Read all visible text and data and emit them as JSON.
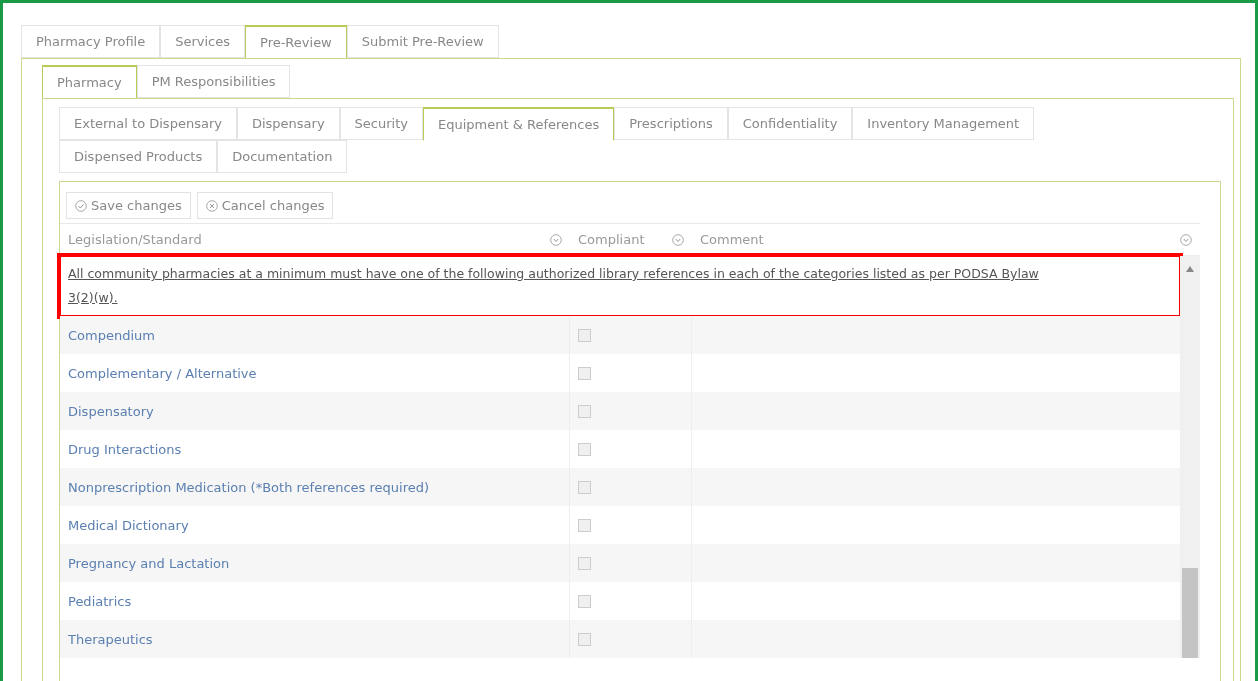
{
  "main_tabs": [
    {
      "label": "Pharmacy Profile",
      "selected": false
    },
    {
      "label": "Services",
      "selected": false
    },
    {
      "label": "Pre-Review",
      "selected": true
    },
    {
      "label": "Submit Pre-Review",
      "selected": false
    }
  ],
  "sub_tabs": [
    {
      "label": "Pharmacy",
      "selected": true
    },
    {
      "label": "PM Responsibilities",
      "selected": false
    }
  ],
  "section_tabs": [
    {
      "label": "External to Dispensary",
      "selected": false
    },
    {
      "label": "Dispensary",
      "selected": false
    },
    {
      "label": "Security",
      "selected": false
    },
    {
      "label": "Equipment & References",
      "selected": true
    },
    {
      "label": "Prescriptions",
      "selected": false
    },
    {
      "label": "Confidentiality",
      "selected": false
    },
    {
      "label": "Inventory Management",
      "selected": false
    },
    {
      "label": "Dispensed Products",
      "selected": false
    },
    {
      "label": "Documentation",
      "selected": false
    }
  ],
  "toolbar": [
    {
      "kind": "save",
      "label": "Save changes"
    },
    {
      "kind": "cancel",
      "label": "Cancel changes"
    }
  ],
  "table": {
    "columns": [
      "Legislation/Standard",
      "Compliant",
      "Comment"
    ],
    "note": {
      "text": "All community pharmacies at a minimum must have one of the following authorized library references in each of the categories listed as per PODSA Bylaw 3(2)(w).",
      "highlighted": true
    },
    "rows": [
      {
        "standard": "Compendium",
        "compliant": false
      },
      {
        "standard": "Complementary / Alternative",
        "compliant": false
      },
      {
        "standard": "Dispensatory",
        "compliant": false
      },
      {
        "standard": "Drug Interactions",
        "compliant": false
      },
      {
        "standard": "Nonprescription Medication (*Both references required)",
        "compliant": false
      },
      {
        "standard": "Medical Dictionary",
        "compliant": false
      },
      {
        "standard": "Pregnancy and Lactation",
        "compliant": false
      },
      {
        "standard": "Pediatrics",
        "compliant": false
      },
      {
        "standard": "Therapeutics",
        "compliant": false
      }
    ]
  }
}
